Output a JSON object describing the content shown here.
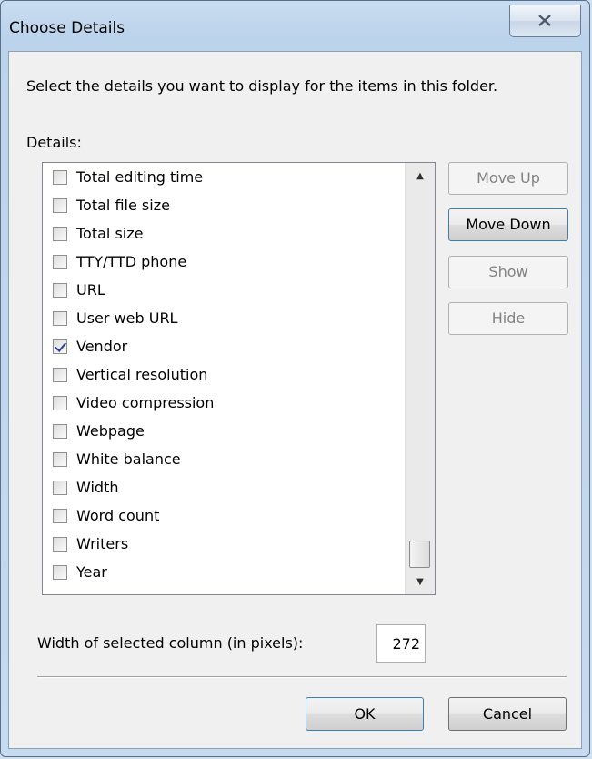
{
  "window": {
    "title": "Choose Details",
    "close_label": "Close"
  },
  "instruction": "Select the details you want to display for the items in this folder.",
  "details_label": "Details:",
  "details_items": [
    {
      "label": "Total editing time",
      "checked": false
    },
    {
      "label": "Total file size",
      "checked": false
    },
    {
      "label": "Total size",
      "checked": false
    },
    {
      "label": "TTY/TTD phone",
      "checked": false
    },
    {
      "label": "URL",
      "checked": false
    },
    {
      "label": "User web URL",
      "checked": false
    },
    {
      "label": "Vendor",
      "checked": true
    },
    {
      "label": "Vertical resolution",
      "checked": false
    },
    {
      "label": "Video compression",
      "checked": false
    },
    {
      "label": "Webpage",
      "checked": false
    },
    {
      "label": "White balance",
      "checked": false
    },
    {
      "label": "Width",
      "checked": false
    },
    {
      "label": "Word count",
      "checked": false
    },
    {
      "label": "Writers",
      "checked": false
    },
    {
      "label": "Year",
      "checked": false
    }
  ],
  "buttons": {
    "move_up": "Move Up",
    "move_down": "Move Down",
    "show": "Show",
    "hide": "Hide",
    "ok": "OK",
    "cancel": "Cancel"
  },
  "width_label": "Width of selected column (in pixels):",
  "width_value": "272",
  "colors": {
    "titlebar": "#bcd3ec",
    "dialog_bg": "#f0f0f0",
    "check_mark": "#2a3f8f",
    "focus_border": "#3c7fb1"
  }
}
